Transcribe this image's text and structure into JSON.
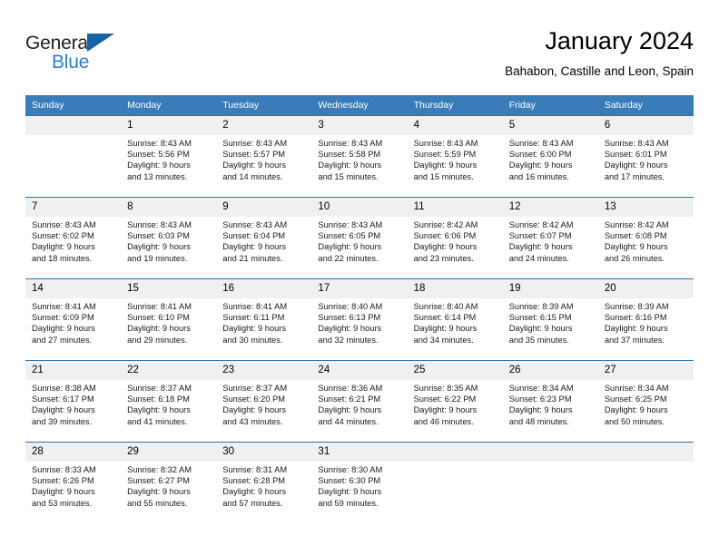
{
  "brand": {
    "name_part1": "General",
    "name_part2": "Blue",
    "triangle_icon": "triangle-icon",
    "accent_color": "#2a7fc9",
    "logo_triangle_color": "#1464aa"
  },
  "header": {
    "title": "January 2024",
    "subtitle": "Bahabon, Castille and Leon, Spain"
  },
  "theme": {
    "header_row_bg": "#3a7cba",
    "header_row_text": "#ffffff",
    "row_divider": "#2f72b0",
    "daynum_bg": "#f0f0f0"
  },
  "calendar": {
    "weekday_headers": [
      "Sunday",
      "Monday",
      "Tuesday",
      "Wednesday",
      "Thursday",
      "Friday",
      "Saturday"
    ],
    "weeks": [
      [
        {
          "day": "",
          "lines": []
        },
        {
          "day": "1",
          "lines": [
            "Sunrise: 8:43 AM",
            "Sunset: 5:56 PM",
            "Daylight: 9 hours",
            "and 13 minutes."
          ]
        },
        {
          "day": "2",
          "lines": [
            "Sunrise: 8:43 AM",
            "Sunset: 5:57 PM",
            "Daylight: 9 hours",
            "and 14 minutes."
          ]
        },
        {
          "day": "3",
          "lines": [
            "Sunrise: 8:43 AM",
            "Sunset: 5:58 PM",
            "Daylight: 9 hours",
            "and 15 minutes."
          ]
        },
        {
          "day": "4",
          "lines": [
            "Sunrise: 8:43 AM",
            "Sunset: 5:59 PM",
            "Daylight: 9 hours",
            "and 15 minutes."
          ]
        },
        {
          "day": "5",
          "lines": [
            "Sunrise: 8:43 AM",
            "Sunset: 6:00 PM",
            "Daylight: 9 hours",
            "and 16 minutes."
          ]
        },
        {
          "day": "6",
          "lines": [
            "Sunrise: 8:43 AM",
            "Sunset: 6:01 PM",
            "Daylight: 9 hours",
            "and 17 minutes."
          ]
        }
      ],
      [
        {
          "day": "7",
          "lines": [
            "Sunrise: 8:43 AM",
            "Sunset: 6:02 PM",
            "Daylight: 9 hours",
            "and 18 minutes."
          ]
        },
        {
          "day": "8",
          "lines": [
            "Sunrise: 8:43 AM",
            "Sunset: 6:03 PM",
            "Daylight: 9 hours",
            "and 19 minutes."
          ]
        },
        {
          "day": "9",
          "lines": [
            "Sunrise: 8:43 AM",
            "Sunset: 6:04 PM",
            "Daylight: 9 hours",
            "and 21 minutes."
          ]
        },
        {
          "day": "10",
          "lines": [
            "Sunrise: 8:43 AM",
            "Sunset: 6:05 PM",
            "Daylight: 9 hours",
            "and 22 minutes."
          ]
        },
        {
          "day": "11",
          "lines": [
            "Sunrise: 8:42 AM",
            "Sunset: 6:06 PM",
            "Daylight: 9 hours",
            "and 23 minutes."
          ]
        },
        {
          "day": "12",
          "lines": [
            "Sunrise: 8:42 AM",
            "Sunset: 6:07 PM",
            "Daylight: 9 hours",
            "and 24 minutes."
          ]
        },
        {
          "day": "13",
          "lines": [
            "Sunrise: 8:42 AM",
            "Sunset: 6:08 PM",
            "Daylight: 9 hours",
            "and 26 minutes."
          ]
        }
      ],
      [
        {
          "day": "14",
          "lines": [
            "Sunrise: 8:41 AM",
            "Sunset: 6:09 PM",
            "Daylight: 9 hours",
            "and 27 minutes."
          ]
        },
        {
          "day": "15",
          "lines": [
            "Sunrise: 8:41 AM",
            "Sunset: 6:10 PM",
            "Daylight: 9 hours",
            "and 29 minutes."
          ]
        },
        {
          "day": "16",
          "lines": [
            "Sunrise: 8:41 AM",
            "Sunset: 6:11 PM",
            "Daylight: 9 hours",
            "and 30 minutes."
          ]
        },
        {
          "day": "17",
          "lines": [
            "Sunrise: 8:40 AM",
            "Sunset: 6:13 PM",
            "Daylight: 9 hours",
            "and 32 minutes."
          ]
        },
        {
          "day": "18",
          "lines": [
            "Sunrise: 8:40 AM",
            "Sunset: 6:14 PM",
            "Daylight: 9 hours",
            "and 34 minutes."
          ]
        },
        {
          "day": "19",
          "lines": [
            "Sunrise: 8:39 AM",
            "Sunset: 6:15 PM",
            "Daylight: 9 hours",
            "and 35 minutes."
          ]
        },
        {
          "day": "20",
          "lines": [
            "Sunrise: 8:39 AM",
            "Sunset: 6:16 PM",
            "Daylight: 9 hours",
            "and 37 minutes."
          ]
        }
      ],
      [
        {
          "day": "21",
          "lines": [
            "Sunrise: 8:38 AM",
            "Sunset: 6:17 PM",
            "Daylight: 9 hours",
            "and 39 minutes."
          ]
        },
        {
          "day": "22",
          "lines": [
            "Sunrise: 8:37 AM",
            "Sunset: 6:18 PM",
            "Daylight: 9 hours",
            "and 41 minutes."
          ]
        },
        {
          "day": "23",
          "lines": [
            "Sunrise: 8:37 AM",
            "Sunset: 6:20 PM",
            "Daylight: 9 hours",
            "and 43 minutes."
          ]
        },
        {
          "day": "24",
          "lines": [
            "Sunrise: 8:36 AM",
            "Sunset: 6:21 PM",
            "Daylight: 9 hours",
            "and 44 minutes."
          ]
        },
        {
          "day": "25",
          "lines": [
            "Sunrise: 8:35 AM",
            "Sunset: 6:22 PM",
            "Daylight: 9 hours",
            "and 46 minutes."
          ]
        },
        {
          "day": "26",
          "lines": [
            "Sunrise: 8:34 AM",
            "Sunset: 6:23 PM",
            "Daylight: 9 hours",
            "and 48 minutes."
          ]
        },
        {
          "day": "27",
          "lines": [
            "Sunrise: 8:34 AM",
            "Sunset: 6:25 PM",
            "Daylight: 9 hours",
            "and 50 minutes."
          ]
        }
      ],
      [
        {
          "day": "28",
          "lines": [
            "Sunrise: 8:33 AM",
            "Sunset: 6:26 PM",
            "Daylight: 9 hours",
            "and 53 minutes."
          ]
        },
        {
          "day": "29",
          "lines": [
            "Sunrise: 8:32 AM",
            "Sunset: 6:27 PM",
            "Daylight: 9 hours",
            "and 55 minutes."
          ]
        },
        {
          "day": "30",
          "lines": [
            "Sunrise: 8:31 AM",
            "Sunset: 6:28 PM",
            "Daylight: 9 hours",
            "and 57 minutes."
          ]
        },
        {
          "day": "31",
          "lines": [
            "Sunrise: 8:30 AM",
            "Sunset: 6:30 PM",
            "Daylight: 9 hours",
            "and 59 minutes."
          ]
        },
        {
          "day": "",
          "lines": []
        },
        {
          "day": "",
          "lines": []
        },
        {
          "day": "",
          "lines": []
        }
      ]
    ]
  }
}
